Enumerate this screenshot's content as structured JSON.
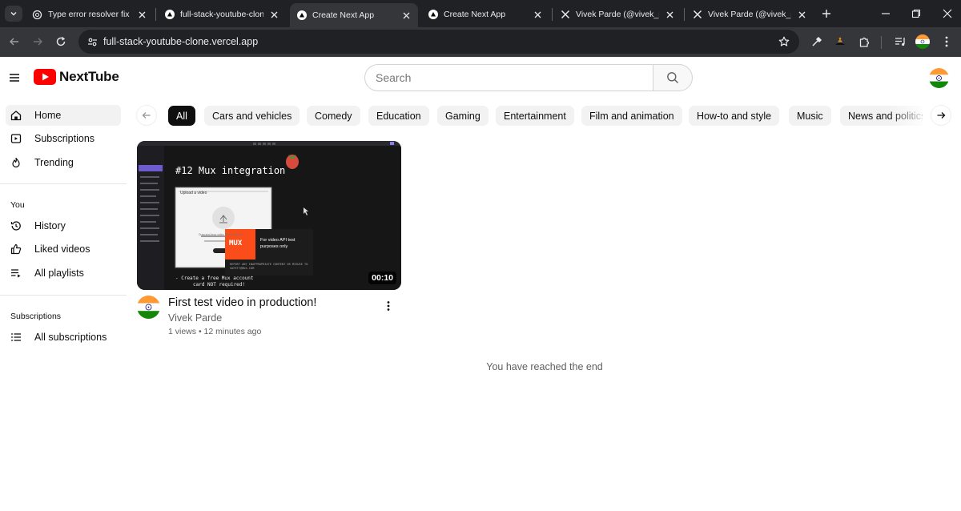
{
  "browser": {
    "tabs": [
      {
        "title": "Type error resolver fix",
        "favicon": "openai-icon",
        "active": false
      },
      {
        "title": "full-stack-youtube-clone -",
        "favicon": "vercel-icon",
        "active": false
      },
      {
        "title": "Create Next App",
        "favicon": "vercel-icon",
        "active": true
      },
      {
        "title": "Create Next App",
        "favicon": "vercel-icon",
        "active": false
      },
      {
        "title": "Vivek Parde (@vivek_parde",
        "favicon": "x-icon",
        "active": false
      },
      {
        "title": "Vivek Parde (@vivek_parde",
        "favicon": "x-icon",
        "active": false
      }
    ],
    "url": "full-stack-youtube-clone.vercel.app"
  },
  "app": {
    "brand": "NextTube",
    "brand_color": "#ff0000",
    "search_placeholder": "Search"
  },
  "sidebar": {
    "main": [
      {
        "label": "Home",
        "icon": "home-icon",
        "active": true
      },
      {
        "label": "Subscriptions",
        "icon": "subscriptions-icon",
        "active": false
      },
      {
        "label": "Trending",
        "icon": "flame-icon",
        "active": false
      }
    ],
    "you_heading": "You",
    "you": [
      {
        "label": "History",
        "icon": "history-icon"
      },
      {
        "label": "Liked videos",
        "icon": "thumbs-up-icon"
      },
      {
        "label": "All playlists",
        "icon": "playlist-icon"
      }
    ],
    "subs_heading": "Subscriptions",
    "subs": [
      {
        "label": "All subscriptions",
        "icon": "list-icon"
      }
    ]
  },
  "categories": {
    "items": [
      "All",
      "Cars and vehicles",
      "Comedy",
      "Education",
      "Gaming",
      "Entertainment",
      "Film and animation",
      "How-to and style",
      "Music",
      "News and politics"
    ],
    "selected": "All"
  },
  "video": {
    "title": "First test video in production!",
    "channel": "Vivek Parde",
    "views": "1 views",
    "age": "12 minutes ago",
    "duration": "00:10",
    "thumbnail": {
      "heading": "#12 Mux integration",
      "dialog_title": "Upload a video",
      "dialog_text": "Drag and drop video files to upload",
      "mux_logo": "MUX",
      "mux_caption": "For video API test purposes only",
      "mux_report": "REPORT ANY INAPPROPRIATE CONTENT OR MISUSE TO SAFETY@MUX.COM",
      "note_line1": "- Create a free Mux account",
      "note_line2": "card NOT required!"
    }
  },
  "end_message": "You have reached the end"
}
